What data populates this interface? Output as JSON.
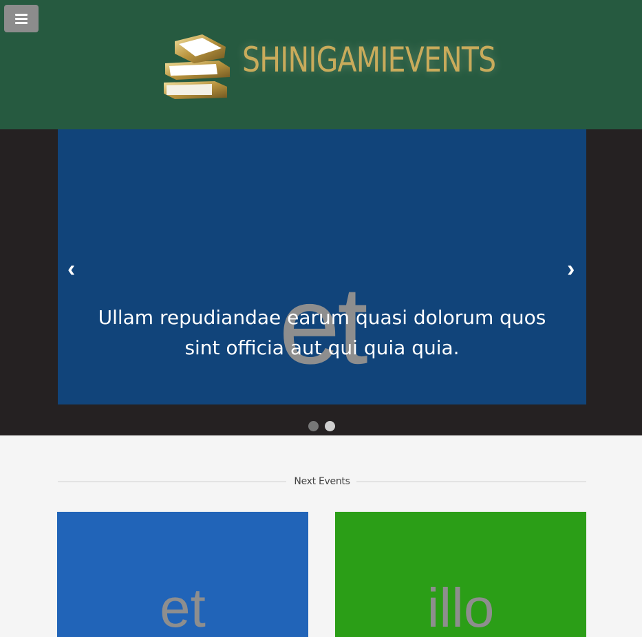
{
  "header": {
    "menu_icon": "hamburger-menu-icon",
    "logo_text": "SHINIGAMIEVENTS",
    "logo_icon": "stacked-books-icon",
    "background": "#265a40"
  },
  "carousel": {
    "slide": {
      "watermark": "et",
      "caption": "Ullam repudiandae earum quasi dolorum quos sint officia aut qui quia quia.",
      "background": "#11447a"
    },
    "prev_label": "‹",
    "next_label": "›",
    "indicators": [
      {
        "active": false
      },
      {
        "active": true
      }
    ]
  },
  "section": {
    "title": "Next Events"
  },
  "events": [
    {
      "watermark": "et",
      "color": "#2164b8"
    },
    {
      "watermark": "illo",
      "color": "#2b9e17"
    }
  ]
}
